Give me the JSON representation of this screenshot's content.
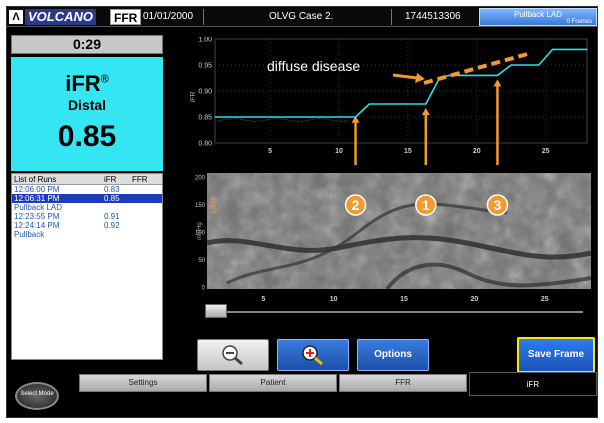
{
  "header": {
    "brand": "VOLCANO",
    "mode": "FFR",
    "date": "01/01/2000",
    "case": "OLVG Case 2.",
    "id": "1744513306",
    "pullback_title": "Pullback LAD",
    "pullback_frames": "0 Frames"
  },
  "timer": "0:29",
  "ifr_panel": {
    "title": "iFR",
    "mark": "®",
    "location": "Distal",
    "value": "0.85"
  },
  "runs": {
    "header": [
      "List of Runs",
      "iFR",
      "FFR"
    ],
    "rows": [
      {
        "time": "12:06:00 PM",
        "ifr": "0.83",
        "ffr": "",
        "selected": false
      },
      {
        "time": "12:06:31 PM",
        "ifr": "0.85",
        "ffr": "",
        "selected": true,
        "note": "Pullback LAD"
      },
      {
        "time": "12:23:55 PM",
        "ifr": "0.91",
        "ffr": "",
        "selected": false
      },
      {
        "time": "12:24:14 PM",
        "ifr": "0.92",
        "ffr": "",
        "selected": false,
        "note": "Pullback"
      }
    ]
  },
  "chart_data": {
    "type": "line",
    "title": "",
    "xlabel": "",
    "ylabel": "iFR",
    "xlim": [
      1,
      28
    ],
    "ylim": [
      0.8,
      1.0
    ],
    "xticks": [
      "5",
      "10",
      "15",
      "20",
      "25"
    ],
    "yticks": [
      "1.00",
      "0.95",
      "0.90",
      "0.85",
      "0.80"
    ],
    "series": [
      {
        "color": "#27e3e8",
        "x": [
          1,
          11.2,
          12.2,
          16.3,
          17.3,
          18.0,
          21.5,
          22.5,
          24.5,
          25.5,
          28
        ],
        "y": [
          0.85,
          0.85,
          0.875,
          0.875,
          0.925,
          0.93,
          0.93,
          0.95,
          0.95,
          0.98,
          0.98
        ]
      }
    ],
    "annotations": [
      {
        "text": "diffuse disease",
        "color": "#ffffff"
      },
      {
        "label": "2",
        "color": "#f29a2e"
      },
      {
        "label": "1",
        "color": "#f29a2e"
      },
      {
        "label": "3",
        "color": "#f29a2e"
      }
    ]
  },
  "image_panel": {
    "ylabel": "mmHg",
    "marker": "L 128",
    "xticks": [
      "5",
      "10",
      "15",
      "20",
      "25"
    ],
    "yticks": [
      "200",
      "150",
      "100",
      "50",
      "0"
    ]
  },
  "slider": {
    "value": 0
  },
  "buttons": {
    "zoom_out": "",
    "zoom_in": "",
    "options": "Options",
    "save_frame": "Save Frame"
  },
  "bottom": {
    "select_mode": "Select Mode",
    "tabs": [
      "Settings",
      "Patient",
      "FFR",
      "iFR"
    ],
    "active_tab": "iFR"
  },
  "colors": {
    "accent": "#33e6f2",
    "button_blue": "#2c6fd6",
    "annotation": "#f29a2e",
    "save_border": "#ffe600"
  }
}
